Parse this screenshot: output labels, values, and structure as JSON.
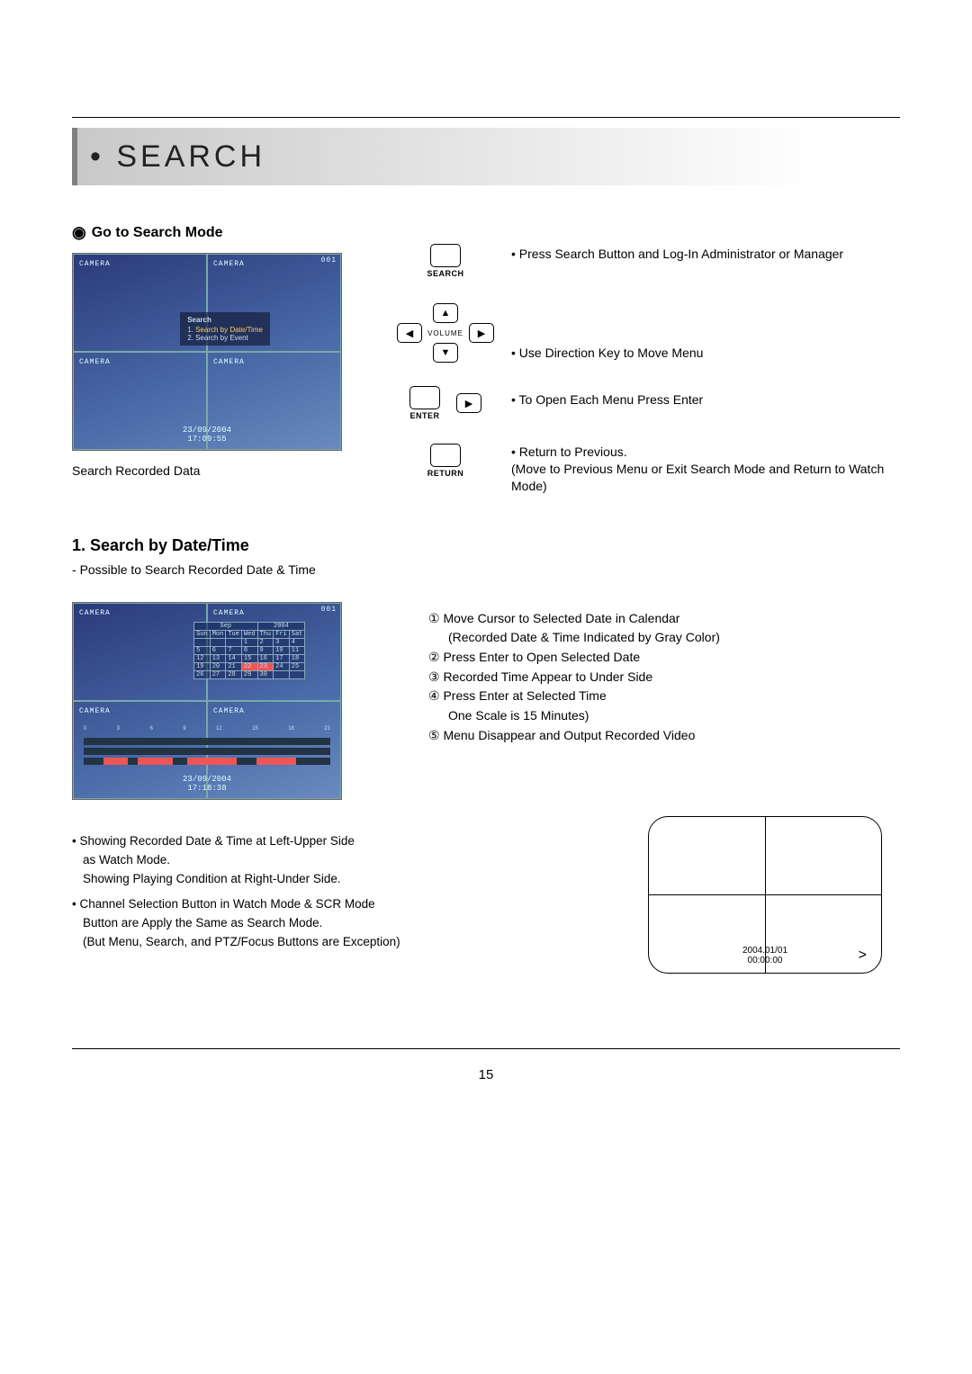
{
  "title": "• SEARCH",
  "sub1": {
    "label": "Go to Search Mode"
  },
  "shot1": {
    "camera_label": "CAMERA",
    "timestamp_line1": "23/09/2004",
    "timestamp_line2": "17:09:55",
    "menu_title": "Search",
    "menu_item1": "1. Search by Date/Time",
    "menu_item2": "2. Search by Event",
    "badge": "001"
  },
  "caption1": "Search Recorded Data",
  "buttons": {
    "search": "SEARCH",
    "enter": "ENTER",
    "return": "RETURN",
    "volume": "VOLUME"
  },
  "controls": {
    "search_text": "Press Search Button and Log-In Administrator or Manager",
    "direction_text": "Use Direction Key to Move Menu",
    "enter_text": "To Open Each Menu Press Enter",
    "return_text1": "Return to Previous.",
    "return_text2": "(Move to Previous Menu or Exit Search Mode and Return to Watch Mode)"
  },
  "section1": {
    "heading": "1. Search by Date/Time",
    "sub": "Possible to Search Recorded Date & Time"
  },
  "shot2": {
    "camera_label": "CAMERA",
    "timestamp_line1": "23/09/2004",
    "timestamp_line2": "17:18:38",
    "cal_month": "Sep",
    "cal_year": "2004",
    "cal_headers": [
      "Sun",
      "Mon",
      "Tue",
      "Wed",
      "Thu",
      "Fri",
      "Sat"
    ],
    "badge": "001"
  },
  "steps": {
    "s1a": "① Move Cursor to Selected Date in Calendar",
    "s1b": "(Recorded Date & Time Indicated by Gray Color)",
    "s2": "② Press Enter to Open Selected Date",
    "s3": "③ Recorded Time Appear to Under Side",
    "s4a": "④ Press Enter at Selected Time",
    "s4b": "One Scale is 15 Minutes)",
    "s5": "⑤ Menu Disappear and Output Recorded Video"
  },
  "notes": {
    "n1a": "• Showing Recorded Date & Time at Left-Upper Side",
    "n1b": "as Watch Mode.",
    "n1c": "Showing Playing Condition at Right-Under Side.",
    "n2a": "• Channel Selection Button in Watch Mode & SCR Mode",
    "n2b": "Button are Apply the Same as Search Mode.",
    "n2c": "(But Menu, Search, and PTZ/Focus Buttons are Exception)"
  },
  "tv": {
    "date": "2004.01/01",
    "time": "00:00:00",
    "play": ">"
  },
  "page_number": "15"
}
